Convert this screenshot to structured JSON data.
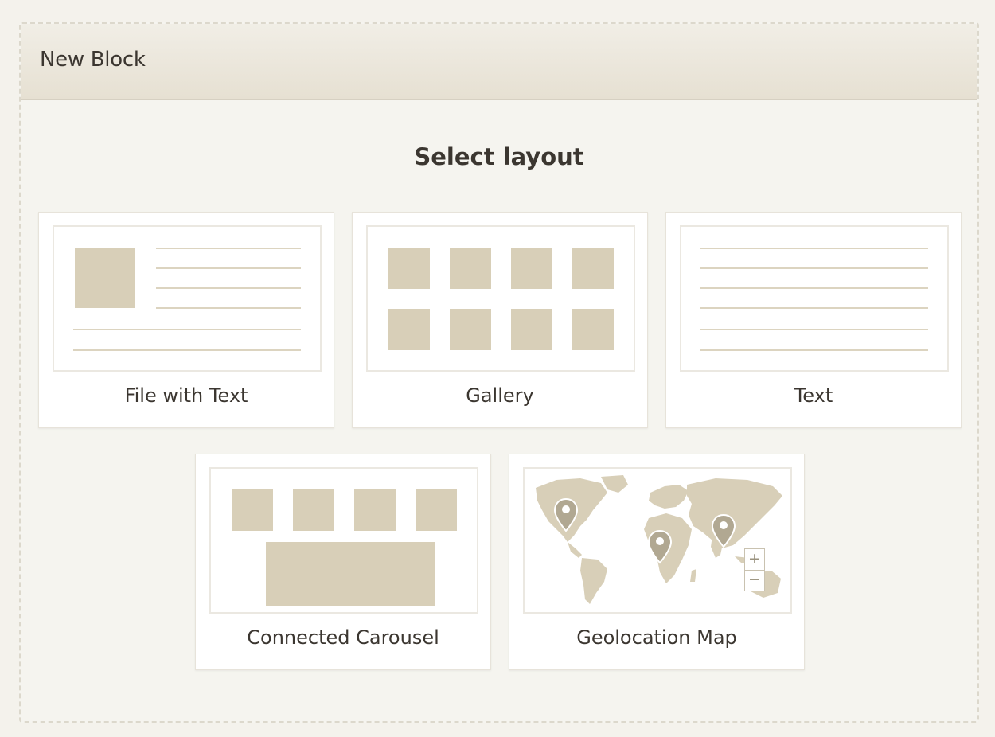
{
  "dialog": {
    "title": "New Block",
    "heading": "Select layout"
  },
  "layouts": [
    {
      "label": "File with Text",
      "icon": "file-with-text-layout-icon"
    },
    {
      "label": "Gallery",
      "icon": "gallery-layout-icon"
    },
    {
      "label": "Text",
      "icon": "text-layout-icon"
    },
    {
      "label": "Connected Carousel",
      "icon": "connected-carousel-layout-icon"
    },
    {
      "label": "Geolocation Map",
      "icon": "geolocation-map-layout-icon"
    }
  ],
  "map": {
    "zoom_in_symbol": "+",
    "zoom_out_symbol": "−"
  },
  "colors": {
    "placeholder": "#d8cfb8",
    "header_gradient_top": "#f1eee6",
    "header_gradient_bottom": "#e6e0d2",
    "text": "#3b3630",
    "pin": "#b1a892"
  }
}
